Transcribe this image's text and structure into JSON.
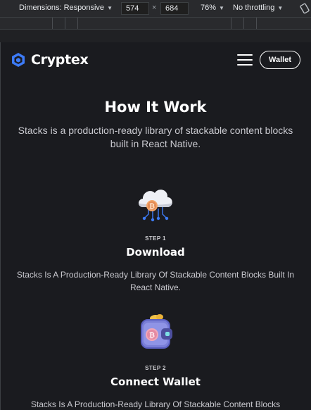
{
  "devtools": {
    "dimensions_label": "Dimensions: Responsive",
    "width_value": "574",
    "times_sign": "×",
    "height_value": "684",
    "zoom": "76%",
    "throttling": "No throttling"
  },
  "header": {
    "brand": "Cryptex",
    "wallet_button": "Wallet"
  },
  "section": {
    "title": "How It Work",
    "subtitle": "Stacks is a production-ready library of stackable content blocks built in React Native."
  },
  "steps": [
    {
      "label": "STEP 1",
      "title": "Download",
      "description": "Stacks Is A Production-Ready Library Of Stackable Content Blocks Built In React Native.",
      "icon": "cloud-bitcoin-icon"
    },
    {
      "label": "STEP 2",
      "title": "Connect Wallet",
      "description": "Stacks Is A Production-Ready Library Of Stackable Content Blocks",
      "icon": "wallet-bitcoin-icon"
    }
  ],
  "colors": {
    "page_background": "#1a1b1f",
    "brand_blue": "#3d7bf7",
    "bitcoin_orange": "#f2a76b",
    "devtools_background": "#292a2d"
  }
}
